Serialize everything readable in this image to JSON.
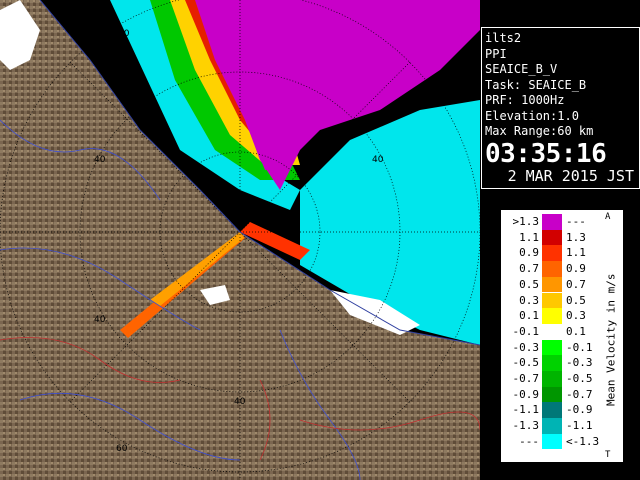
{
  "info": {
    "radar_name": "ilts2",
    "scan_type": "PPI",
    "product": "SEAICE_B_V",
    "task": "Task: SEAICE_B",
    "prf": "PRF: 1000Hz",
    "elevation": "Elevation:1.0",
    "max_range": "Max Range:60 km",
    "time": "03:35:16",
    "date": "2 MAR 2015 JST"
  },
  "range_labels": {
    "upper_left": "60",
    "upper_right": "40",
    "left_mid": "40",
    "left_lower": "40",
    "bottom": "40",
    "bottom_left": "60"
  },
  "legend": {
    "title": "Mean Velocity in m/s",
    "top_marker": "A",
    "bottom_marker": "T",
    "rows": [
      {
        "left": ">1.3",
        "right": "---",
        "color": "#c800c8"
      },
      {
        "left": "1.1",
        "right": "1.3",
        "color": "#d20000"
      },
      {
        "left": "0.9",
        "right": "1.1",
        "color": "#ff3200"
      },
      {
        "left": "0.7",
        "right": "0.9",
        "color": "#ff6400"
      },
      {
        "left": "0.5",
        "right": "0.7",
        "color": "#ff9600"
      },
      {
        "left": "0.3",
        "right": "0.5",
        "color": "#ffc800"
      },
      {
        "left": "0.1",
        "right": "0.3",
        "color": "#ffff00"
      },
      {
        "left": "-0.1",
        "right": "0.1",
        "color": "#ffffff"
      },
      {
        "left": "-0.3",
        "right": "-0.1",
        "color": "#00ff00"
      },
      {
        "left": "-0.5",
        "right": "-0.3",
        "color": "#00d200"
      },
      {
        "left": "-0.7",
        "right": "-0.5",
        "color": "#00b400"
      },
      {
        "left": "-0.9",
        "right": "-0.7",
        "color": "#009600"
      },
      {
        "left": "-1.1",
        "right": "-0.9",
        "color": "#007878"
      },
      {
        "left": "-1.3",
        "right": "-1.1",
        "color": "#00b4b4"
      },
      {
        "left": "---",
        "right": "<-1.3",
        "color": "#00ffff"
      }
    ]
  },
  "colors": {
    "land": "#7b6650",
    "sea_ice": "#00e6ec",
    "magenta": "#c800c8"
  }
}
